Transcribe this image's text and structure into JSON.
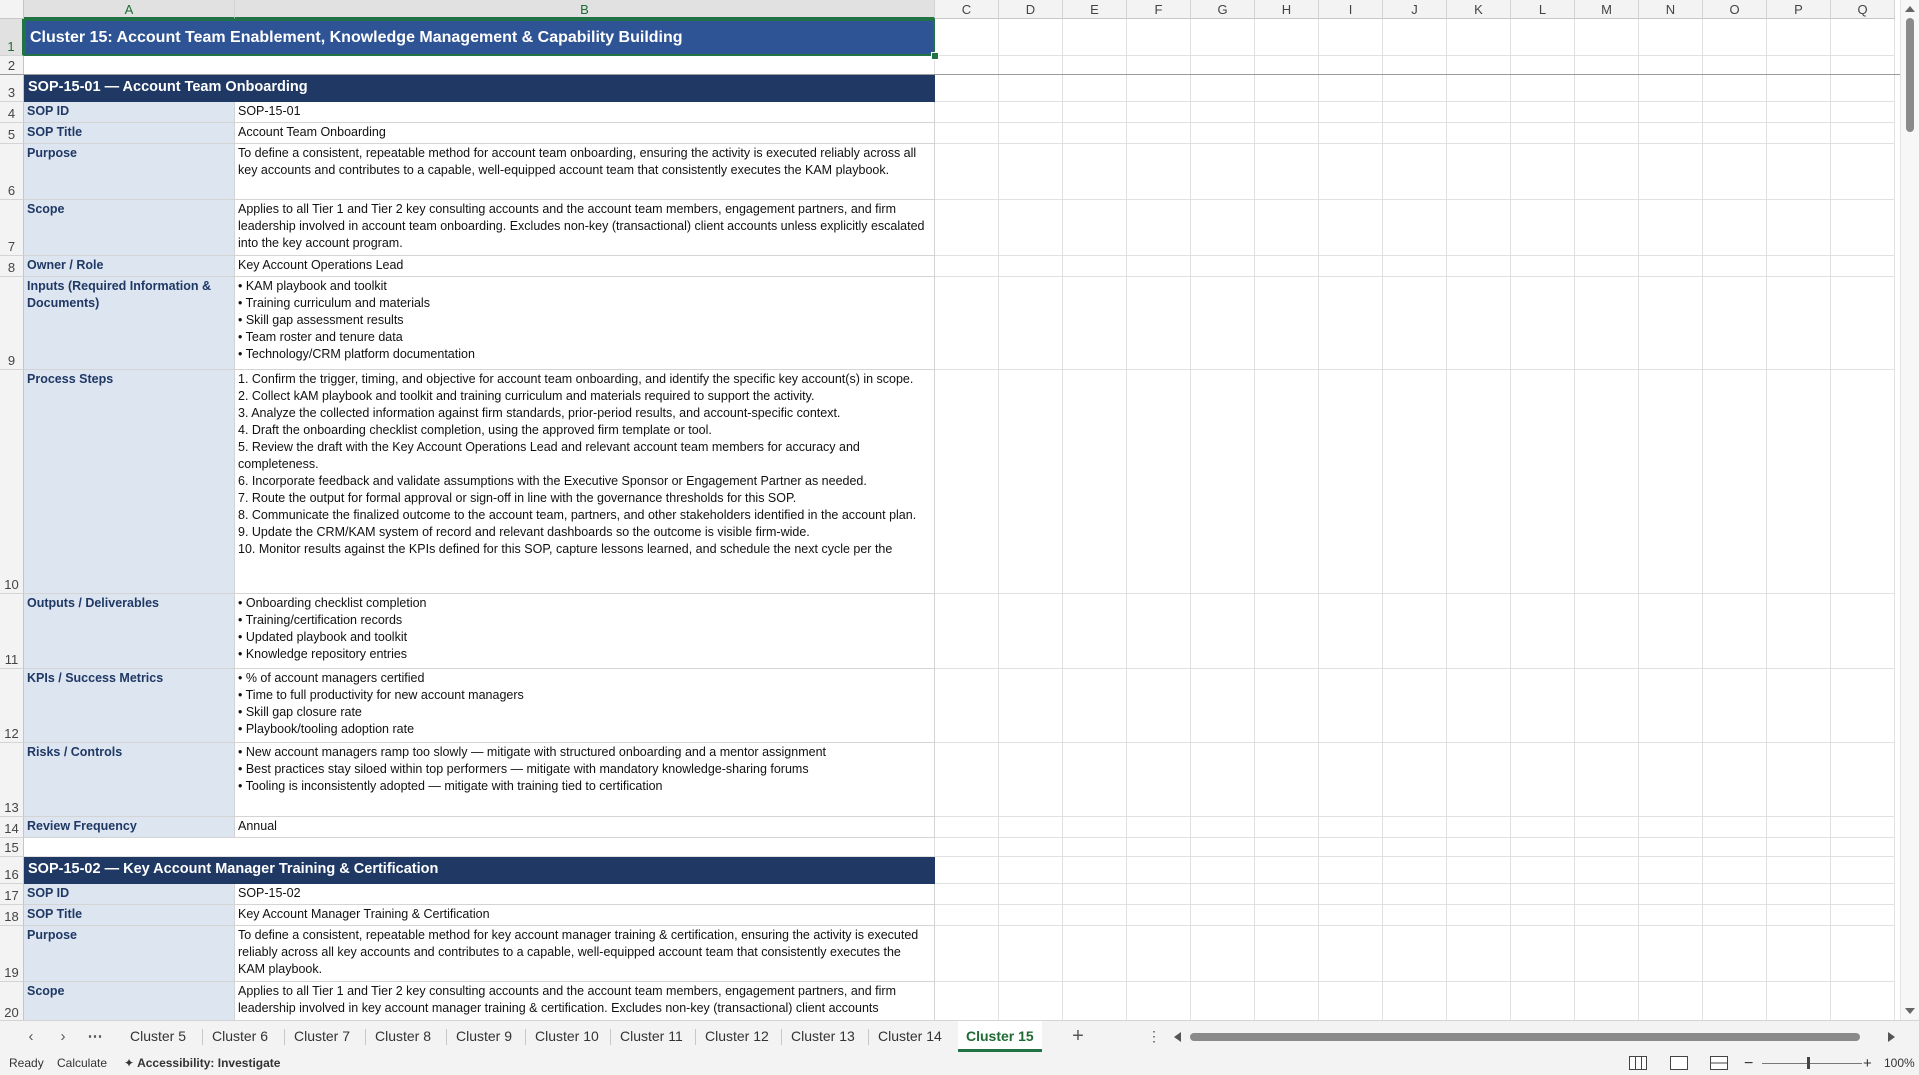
{
  "columns": [
    "A",
    "B",
    "C",
    "D",
    "E",
    "F",
    "G",
    "H",
    "I",
    "J",
    "K",
    "L",
    "M",
    "N",
    "O",
    "P",
    "Q"
  ],
  "title": "Cluster 15: Account Team Enablement, Knowledge Management & Capability Building",
  "sop1_header": "SOP-15-01  —  Account Team Onboarding",
  "sop1_rows": [
    {
      "row": "4",
      "label": "SOP ID",
      "value": "SOP-15-01"
    },
    {
      "row": "5",
      "label": "SOP Title",
      "value": "Account Team Onboarding"
    },
    {
      "row": "6",
      "label": "Purpose",
      "value": "To define a consistent, repeatable method for account team onboarding, ensuring the activity is executed reliably across all key accounts and contributes to a capable, well-equipped account team that consistently executes the KAM playbook."
    },
    {
      "row": "7",
      "label": "Scope",
      "value": "Applies to all Tier 1 and Tier 2 key consulting accounts and the account team members, engagement partners, and firm leadership involved in account team onboarding. Excludes non-key (transactional) client accounts unless explicitly escalated into the key account program."
    },
    {
      "row": "8",
      "label": "Owner / Role",
      "value": "Key Account Operations Lead"
    },
    {
      "row": "9",
      "label": "Inputs (Required Information & Documents)",
      "value": "• KAM playbook and toolkit\n• Training curriculum and materials\n• Skill gap assessment results\n• Team roster and tenure data\n• Technology/CRM platform documentation"
    },
    {
      "row": "10",
      "label": "Process Steps",
      "value": "1. Confirm the trigger, timing, and objective for account team onboarding, and identify the specific key account(s) in scope.\n2. Collect kAM playbook and toolkit and training curriculum and materials required to support the activity.\n3. Analyze the collected information against firm standards, prior-period results, and account-specific context.\n4. Draft the onboarding checklist completion, using the approved firm template or tool.\n5. Review the draft with the Key Account Operations Lead and relevant account team members for accuracy and completeness.\n6. Incorporate feedback and validate assumptions with the Executive Sponsor or Engagement Partner as needed.\n7. Route the output for formal approval or sign-off in line with the governance thresholds for this SOP.\n8. Communicate the finalized outcome to the account team, partners, and other stakeholders identified in the account plan.\n9. Update the CRM/KAM system of record and relevant dashboards so the outcome is visible firm-wide.\n10. Monitor results against the KPIs defined for this SOP, capture lessons learned, and schedule the next cycle per the"
    },
    {
      "row": "11",
      "label": "Outputs / Deliverables",
      "value": "• Onboarding checklist completion\n• Training/certification records\n• Updated playbook and toolkit\n• Knowledge repository entries"
    },
    {
      "row": "12",
      "label": "KPIs / Success Metrics",
      "value": "• % of account managers certified\n• Time to full productivity for new account managers\n• Skill gap closure rate\n• Playbook/tooling adoption rate"
    },
    {
      "row": "13",
      "label": "Risks / Controls",
      "value": "• New account managers ramp too slowly — mitigate with structured onboarding and a mentor assignment\n• Best practices stay siloed within top performers — mitigate with mandatory knowledge-sharing forums\n• Tooling is inconsistently adopted — mitigate with training tied to certification"
    },
    {
      "row": "14",
      "label": "Review Frequency",
      "value": "Annual"
    }
  ],
  "sop2_header": "SOP-15-02  —  Key Account Manager Training & Certification",
  "sop2_rows": [
    {
      "row": "17",
      "label": "SOP ID",
      "value": "SOP-15-02"
    },
    {
      "row": "18",
      "label": "SOP Title",
      "value": "Key Account Manager Training & Certification"
    },
    {
      "row": "19",
      "label": "Purpose",
      "value": "To define a consistent, repeatable method for key account manager training & certification, ensuring the activity is executed reliably across all key accounts and contributes to a capable, well-equipped account team that consistently executes the KAM playbook."
    },
    {
      "row": "20",
      "label": "Scope",
      "value": "Applies to all Tier 1 and Tier 2 key consulting accounts and the account team members, engagement partners, and firm leadership involved in key account manager training & certification. Excludes non-key (transactional) client accounts"
    }
  ],
  "row_numbers": [
    "1",
    "2",
    "3",
    "15",
    "16"
  ],
  "tabs": [
    "Cluster 5",
    "Cluster 6",
    "Cluster 7",
    "Cluster 8",
    "Cluster 9",
    "Cluster 10",
    "Cluster 11",
    "Cluster 12",
    "Cluster 13",
    "Cluster 14",
    "Cluster 15"
  ],
  "active_tab": "Cluster 15",
  "status": {
    "ready": "Ready",
    "calculate": "Calculate",
    "accessibility": "Accessibility: Investigate",
    "zoom": "100%"
  },
  "colors": {
    "title_bg": "#2f5496",
    "header_bg": "#1f3864",
    "label_bg": "#dde5f1",
    "accent": "#217346"
  }
}
